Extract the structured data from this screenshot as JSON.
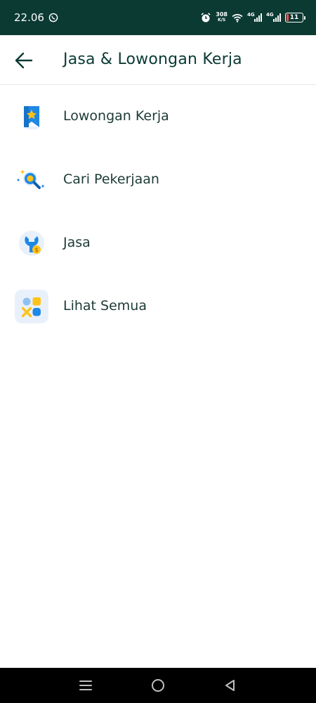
{
  "status_bar": {
    "time": "22.06",
    "net_speed_value": "308",
    "net_speed_unit": "K/S",
    "signal1_label": "4G",
    "signal2_label": "4G",
    "battery_level": "11",
    "icons": [
      "whatsapp-icon",
      "alarm-icon",
      "wifi-icon",
      "signal-icon",
      "battery-icon"
    ]
  },
  "header": {
    "title": "Jasa & Lowongan Kerja",
    "back_icon": "arrow-left-icon"
  },
  "menu": {
    "items": [
      {
        "label": "Lowongan Kerja",
        "icon": "bookmark-star-icon"
      },
      {
        "label": "Cari Pekerjaan",
        "icon": "search-sparkle-icon"
      },
      {
        "label": "Jasa",
        "icon": "wrench-coin-icon"
      },
      {
        "label": "Lihat Semua",
        "icon": "all-categories-icon"
      }
    ]
  },
  "nav_bar": {
    "icons": [
      "menu-icon",
      "home-circle-icon",
      "back-triangle-icon"
    ]
  },
  "colors": {
    "status_bar_bg": "#0b3a33",
    "title_text": "#0b3a33",
    "label_text": "#1d3a36",
    "accent_blue": "#1e88e5",
    "accent_yellow": "#ffc21a",
    "nav_bar_bg": "#000000"
  }
}
